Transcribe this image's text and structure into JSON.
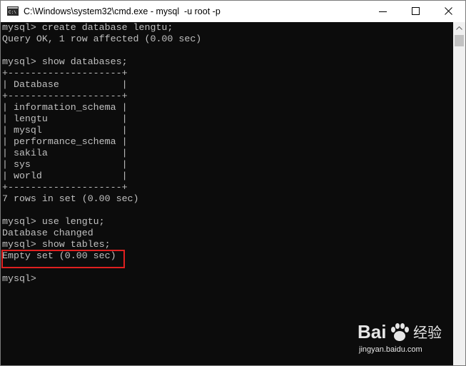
{
  "window": {
    "title": "C:\\Windows\\system32\\cmd.exe - mysql  -u root -p",
    "app_icon": "cmd-icon"
  },
  "controls": {
    "minimize_icon": "minimize-icon",
    "maximize_icon": "maximize-icon",
    "close_icon": "close-icon"
  },
  "console": {
    "lines": [
      "mysql> create database lengtu;",
      "Query OK, 1 row affected (0.00 sec)",
      "",
      "mysql> show databases;",
      "+--------------------+",
      "| Database           |",
      "+--------------------+",
      "| information_schema |",
      "| lengtu             |",
      "| mysql              |",
      "| performance_schema |",
      "| sakila             |",
      "| sys                |",
      "| world              |",
      "+--------------------+",
      "7 rows in set (0.00 sec)",
      "",
      "mysql> use lengtu;",
      "Database changed",
      "mysql> show tables;",
      "Empty set (0.00 sec)",
      "",
      "mysql>"
    ],
    "text_color": "#c0c0c0",
    "background_color": "#0c0c0c",
    "highlight_color": "#e02020"
  },
  "watermark": {
    "brand": "Bai",
    "brand_suffix": "经验",
    "url": "jingyan.baidu.com"
  }
}
